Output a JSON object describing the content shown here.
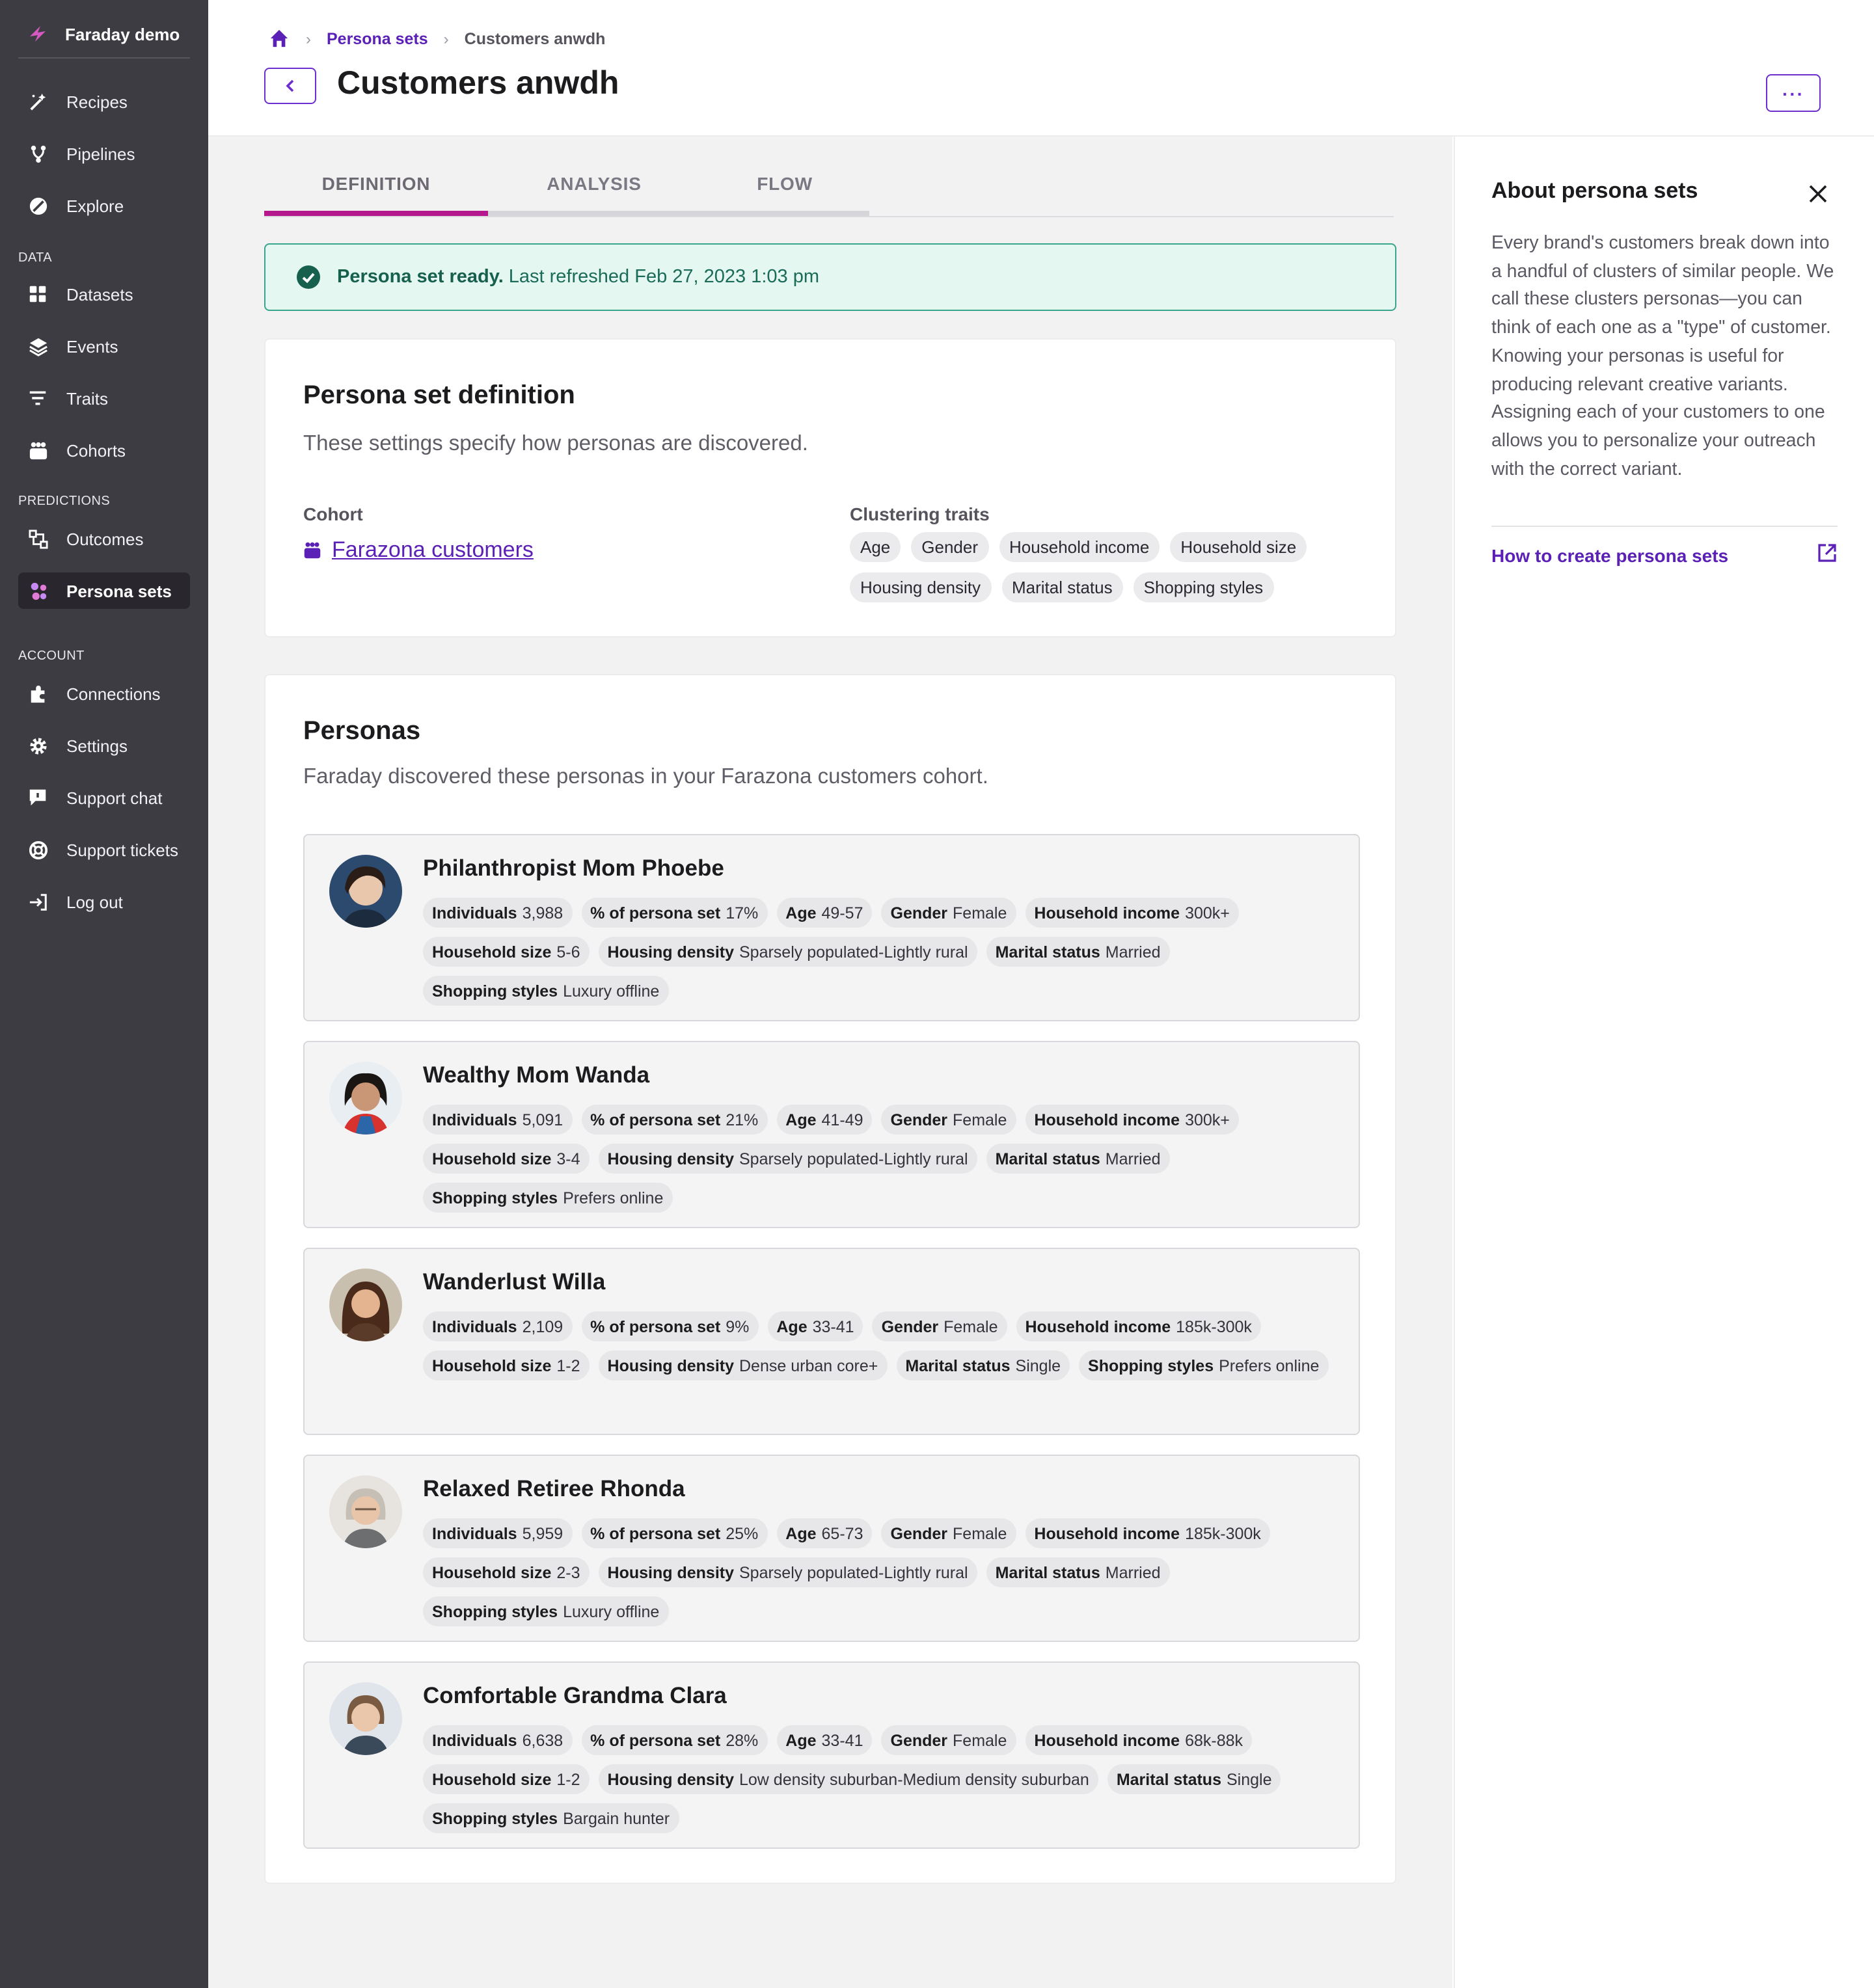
{
  "app": {
    "name": "Faraday demo"
  },
  "sidebar": {
    "items": [
      {
        "label": "Recipes",
        "icon": "wand-icon"
      },
      {
        "label": "Pipelines",
        "icon": "pipeline-icon"
      },
      {
        "label": "Explore",
        "icon": "explore-icon"
      }
    ],
    "data_section": "DATA",
    "data_items": [
      {
        "label": "Datasets",
        "icon": "grid-icon"
      },
      {
        "label": "Events",
        "icon": "layers-icon"
      },
      {
        "label": "Traits",
        "icon": "filter-icon"
      },
      {
        "label": "Cohorts",
        "icon": "people-icon"
      }
    ],
    "predictions_section": "PREDICTIONS",
    "prediction_items": [
      {
        "label": "Outcomes",
        "icon": "outcomes-icon"
      },
      {
        "label": "Persona sets",
        "icon": "persona-icon",
        "active": true
      }
    ],
    "account_section": "ACCOUNT",
    "account_items": [
      {
        "label": "Connections",
        "icon": "puzzle-icon"
      },
      {
        "label": "Settings",
        "icon": "gear-icon"
      },
      {
        "label": "Support chat",
        "icon": "chat-icon"
      },
      {
        "label": "Support tickets",
        "icon": "lifebuoy-icon"
      },
      {
        "label": "Log out",
        "icon": "logout-icon"
      }
    ]
  },
  "header": {
    "breadcrumb_parent": "Persona sets",
    "breadcrumb_current": "Customers anwdh",
    "title": "Customers anwdh",
    "more_label": "···"
  },
  "tabs": [
    "DEFINITION",
    "ANALYSIS",
    "FLOW"
  ],
  "banner": {
    "status": "Persona set ready.",
    "detail": "Last refreshed Feb 27, 2023 1:03 pm"
  },
  "definition": {
    "title": "Persona set definition",
    "subtitle": "These settings specify how personas are discovered.",
    "cohort_label": "Cohort",
    "cohort_value": "Farazona customers",
    "traits_label": "Clustering traits",
    "traits": [
      "Age",
      "Gender",
      "Household income",
      "Household size",
      "Housing density",
      "Marital status",
      "Shopping styles"
    ]
  },
  "personas_card": {
    "title": "Personas",
    "subtitle": "Faraday discovered these personas in your Farazona customers cohort."
  },
  "personas": [
    {
      "name": "Philanthropist Mom Phoebe",
      "tags": [
        [
          "Individuals",
          "3,988"
        ],
        [
          "% of persona set",
          "17%"
        ],
        [
          "Age",
          "49-57"
        ],
        [
          "Gender",
          "Female"
        ],
        [
          "Household income",
          "300k+"
        ],
        [
          "Household size",
          "5-6"
        ],
        [
          "Housing density",
          "Sparsely populated-Lightly rural"
        ],
        [
          "Marital status",
          "Married"
        ],
        [
          "Shopping styles",
          "Luxury offline"
        ]
      ]
    },
    {
      "name": "Wealthy Mom Wanda",
      "tags": [
        [
          "Individuals",
          "5,091"
        ],
        [
          "% of persona set",
          "21%"
        ],
        [
          "Age",
          "41-49"
        ],
        [
          "Gender",
          "Female"
        ],
        [
          "Household income",
          "300k+"
        ],
        [
          "Household size",
          "3-4"
        ],
        [
          "Housing density",
          "Sparsely populated-Lightly rural"
        ],
        [
          "Marital status",
          "Married"
        ],
        [
          "Shopping styles",
          "Prefers online"
        ]
      ]
    },
    {
      "name": "Wanderlust Willa",
      "tags": [
        [
          "Individuals",
          "2,109"
        ],
        [
          "% of persona set",
          "9%"
        ],
        [
          "Age",
          "33-41"
        ],
        [
          "Gender",
          "Female"
        ],
        [
          "Household income",
          "185k-300k"
        ],
        [
          "Household size",
          "1-2"
        ],
        [
          "Housing density",
          "Dense urban core+"
        ],
        [
          "Marital status",
          "Single"
        ],
        [
          "Shopping styles",
          "Prefers online"
        ]
      ]
    },
    {
      "name": "Relaxed Retiree Rhonda",
      "tags": [
        [
          "Individuals",
          "5,959"
        ],
        [
          "% of persona set",
          "25%"
        ],
        [
          "Age",
          "65-73"
        ],
        [
          "Gender",
          "Female"
        ],
        [
          "Household income",
          "185k-300k"
        ],
        [
          "Household size",
          "2-3"
        ],
        [
          "Housing density",
          "Sparsely populated-Lightly rural"
        ],
        [
          "Marital status",
          "Married"
        ],
        [
          "Shopping styles",
          "Luxury offline"
        ]
      ]
    },
    {
      "name": "Comfortable Grandma Clara",
      "tags": [
        [
          "Individuals",
          "6,638"
        ],
        [
          "% of persona set",
          "28%"
        ],
        [
          "Age",
          "33-41"
        ],
        [
          "Gender",
          "Female"
        ],
        [
          "Household income",
          "68k-88k"
        ],
        [
          "Household size",
          "1-2"
        ],
        [
          "Housing density",
          "Low density suburban-Medium density suburban"
        ],
        [
          "Marital status",
          "Single"
        ],
        [
          "Shopping styles",
          "Bargain hunter"
        ]
      ]
    }
  ],
  "panel": {
    "title": "About persona sets",
    "body": "Every brand's customers break down into a handful of clusters of similar people. We call these clusters personas—you can think of each one as a \"type\" of customer. Knowing your personas is useful for producing relevant creative variants. Assigning each of your customers to one allows you to personalize your outreach with the correct variant.",
    "link": "How to create persona sets"
  },
  "colors": {
    "sidebar_bg": "#3e3c43",
    "accent_purple": "#5b21b6",
    "tab_active": "#b5178c",
    "success_bg": "#e4f7f1",
    "success_border": "#39a58a"
  }
}
